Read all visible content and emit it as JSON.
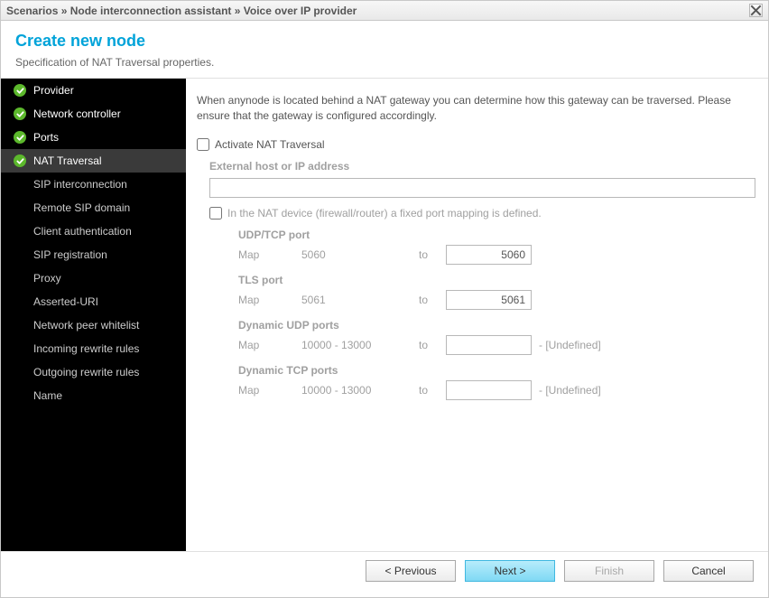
{
  "breadcrumb": "Scenarios » Node interconnection assistant » Voice over IP provider",
  "header": {
    "title": "Create new node",
    "subtitle": "Specification of NAT Traversal properties."
  },
  "sidebar": {
    "items": [
      {
        "label": "Provider",
        "completed": true,
        "active": false
      },
      {
        "label": "Network controller",
        "completed": true,
        "active": false
      },
      {
        "label": "Ports",
        "completed": true,
        "active": false
      },
      {
        "label": "NAT Traversal",
        "completed": true,
        "active": true
      },
      {
        "label": "SIP interconnection",
        "completed": false,
        "active": false
      },
      {
        "label": "Remote SIP domain",
        "completed": false,
        "active": false
      },
      {
        "label": "Client authentication",
        "completed": false,
        "active": false
      },
      {
        "label": "SIP registration",
        "completed": false,
        "active": false
      },
      {
        "label": "Proxy",
        "completed": false,
        "active": false
      },
      {
        "label": "Asserted-URI",
        "completed": false,
        "active": false
      },
      {
        "label": "Network peer whitelist",
        "completed": false,
        "active": false
      },
      {
        "label": "Incoming rewrite rules",
        "completed": false,
        "active": false
      },
      {
        "label": "Outgoing rewrite rules",
        "completed": false,
        "active": false
      },
      {
        "label": "Name",
        "completed": false,
        "active": false
      }
    ]
  },
  "content": {
    "intro": "When anynode is located behind a NAT gateway you can determine how this gateway can be traversed. Please ensure that the gateway is configured accordingly.",
    "activate_label": "Activate NAT Traversal",
    "activate_checked": false,
    "ext_host_label": "External host or IP address",
    "ext_host_value": "",
    "fixed_label": "In the NAT device (firewall/router) a fixed port mapping is defined.",
    "fixed_checked": false,
    "map_label": "Map",
    "to_label": "to",
    "undefined_label": "- [Undefined]",
    "groups": {
      "udp": {
        "title": "UDP/TCP port",
        "from": "5060",
        "to": "5060",
        "suffix": ""
      },
      "tls": {
        "title": "TLS port",
        "from": "5061",
        "to": "5061",
        "suffix": ""
      },
      "dudp": {
        "title": "Dynamic UDP ports",
        "from": "10000 - 13000",
        "to": "",
        "suffix": "- [Undefined]"
      },
      "dtcp": {
        "title": "Dynamic TCP ports",
        "from": "10000 - 13000",
        "to": "",
        "suffix": "- [Undefined]"
      }
    }
  },
  "buttons": {
    "previous": "< Previous",
    "next": "Next >",
    "finish": "Finish",
    "cancel": "Cancel"
  }
}
